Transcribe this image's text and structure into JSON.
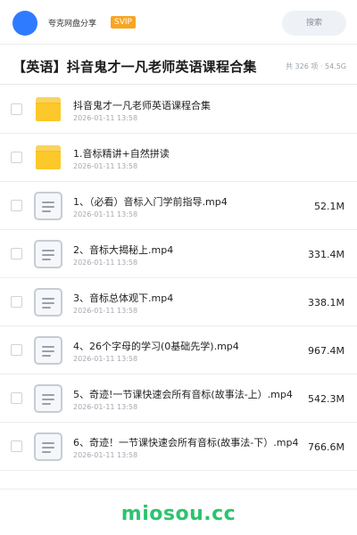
{
  "header": {
    "user_name": "夸克网盘分享",
    "badge": "SVIP",
    "search_placeholder": "搜索",
    "avatar_color": "#2f7bff"
  },
  "folder": {
    "title": "【英语】抖音鬼才一凡老师英语课程合集",
    "meta": "共 326 项 · 54.5G"
  },
  "items": [
    {
      "type": "folder-icon",
      "name": "抖音鬼才一凡老师英语课程合集",
      "date": "2026-01-11 13:58",
      "size": ""
    },
    {
      "type": "folder-icon",
      "name": "1.音标精讲+自然拼读",
      "date": "2026-01-11 13:58",
      "size": ""
    },
    {
      "type": "file-icon",
      "name": "1、（必看）音标入门学前指导.mp4",
      "date": "2026-01-11 13:58",
      "size": "52.1M"
    },
    {
      "type": "file-icon",
      "name": "2、音标大揭秘上.mp4",
      "date": "2026-01-11 13:58",
      "size": "331.4M"
    },
    {
      "type": "file-icon",
      "name": "3、音标总体观下.mp4",
      "date": "2026-01-11 13:58",
      "size": "338.1M"
    },
    {
      "type": "file-icon",
      "name": "4、26个字母的学习(0基础先学).mp4",
      "date": "2026-01-11 13:58",
      "size": "967.4M"
    },
    {
      "type": "file-icon",
      "name": "5、奇迹!一节课快速会所有音标(故事法-上）.mp4",
      "date": "2026-01-11 13:58",
      "size": "542.3M"
    },
    {
      "type": "file-icon",
      "name": "6、奇迹！一节课快速会所有音标(故事法-下）.mp4",
      "date": "2026-01-11 13:58",
      "size": "766.6M"
    }
  ],
  "watermark": "miosou.cc",
  "colors": {
    "accent": "#2f7bff",
    "svip": "#f6a623",
    "folder": "#fcc82a",
    "watermark": "#2cc46e"
  }
}
